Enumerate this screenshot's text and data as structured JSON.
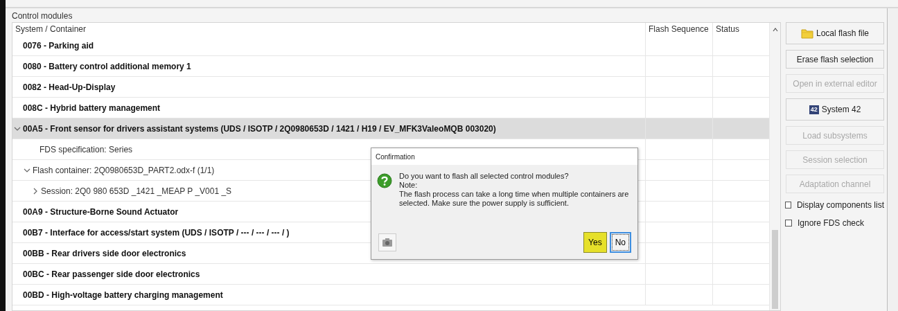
{
  "panel": {
    "title": "Control modules"
  },
  "table": {
    "columns": [
      "System / Container",
      "Flash Sequence",
      "Status"
    ],
    "rows": [
      {
        "kind": "module",
        "label": "0076 - Parking aid",
        "selected": false
      },
      {
        "kind": "module",
        "label": "0080 - Battery control additional memory 1",
        "selected": false
      },
      {
        "kind": "module",
        "label": "0082 - Head-Up-Display",
        "selected": false
      },
      {
        "kind": "module",
        "label": "008C - Hybrid battery management",
        "selected": false
      },
      {
        "kind": "module",
        "label": "00A5 - Front sensor for drivers assistant systems  (UDS / ISOTP / 2Q0980653D / 1421 / H19 / EV_MFK3ValeoMQB 003020)",
        "selected": true,
        "expanded": true,
        "children": [
          {
            "kind": "detail",
            "label": "FDS specification: Series",
            "selected": false
          },
          {
            "kind": "detail",
            "label": "Flash container: 2Q0980653D_PART2.odx-f (1/1)",
            "selected": false,
            "expanded": true,
            "children": [
              {
                "kind": "detail",
                "label": "Session: 2Q0 980 653D _1421 _MEAP P _V001 _S",
                "selected": false,
                "expanded": false
              }
            ]
          }
        ]
      },
      {
        "kind": "module",
        "label": "00A9 - Structure-Borne Sound Actuator",
        "selected": false
      },
      {
        "kind": "module",
        "label": "00B7 - Interface for access/start system  (UDS / ISOTP / --- / --- / --- /  )",
        "selected": false
      },
      {
        "kind": "module",
        "label": "00BB - Rear drivers side door electronics",
        "selected": false
      },
      {
        "kind": "module",
        "label": "00BC - Rear passenger side door electronics",
        "selected": false
      },
      {
        "kind": "module",
        "label": "00BD - High-voltage battery charging management",
        "selected": false
      }
    ]
  },
  "actions": [
    {
      "kind": "folder",
      "label": "Local flash file",
      "disabled": false
    },
    {
      "kind": "button",
      "label": "Erase flash selection",
      "disabled": false
    },
    {
      "kind": "button",
      "label": "Open in external editor",
      "disabled": true
    },
    {
      "kind": "badge",
      "badge": "42",
      "label": "System 42",
      "disabled": false
    },
    {
      "kind": "button",
      "label": "Load subsystems",
      "disabled": true
    },
    {
      "kind": "button",
      "label": "Session selection",
      "disabled": true
    },
    {
      "kind": "button",
      "label": "Adaptation channel",
      "disabled": true
    },
    {
      "kind": "checkbox",
      "label": "Display components list",
      "checked": false
    },
    {
      "kind": "checkbox",
      "label": "Ignore FDS check",
      "checked": false
    }
  ],
  "dialog": {
    "title": "Confirmation",
    "question": "Do you want to flash all selected control modules?",
    "note_label": "Note:",
    "note": "The flash process can take a long time when multiple containers are selected. Make sure the power supply is sufficient.",
    "buttons": [
      {
        "label": "Yes",
        "highlighted": true,
        "focused": false
      },
      {
        "label": "No",
        "highlighted": false,
        "focused": true
      }
    ]
  }
}
